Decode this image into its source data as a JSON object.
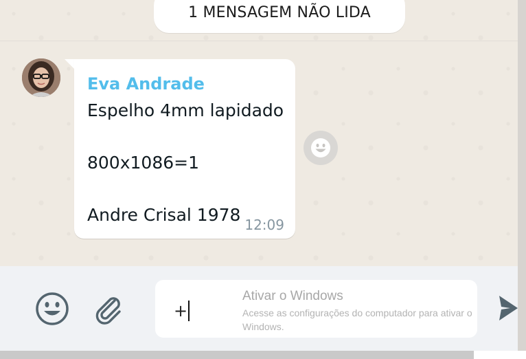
{
  "unread_banner": {
    "label": "1 MENSAGEM NÃO LIDA"
  },
  "message": {
    "sender": "Eva Andrade",
    "lines": [
      "Espelho 4mm lapidado",
      "800x1086=1",
      "Andre Crisal 1978"
    ],
    "time": "12:09",
    "avatar_icon": "contact-avatar"
  },
  "composer": {
    "input_value": "+",
    "emoji_icon": "emoji-icon",
    "attach_icon": "paperclip-icon",
    "send_icon": "send-icon"
  },
  "windows_watermark": {
    "title": "Ativar o Windows",
    "body": "Acesse as configurações do computador para ativar o Windows."
  },
  "colors": {
    "sender_name": "#53bdeb",
    "chat_background": "#efeae2",
    "composer_background": "#f0f2f5",
    "icon_gray": "#54656f"
  }
}
